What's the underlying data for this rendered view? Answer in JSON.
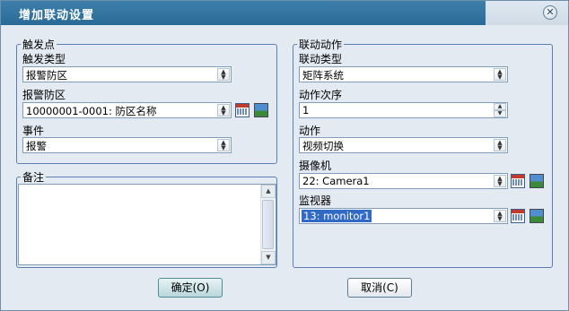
{
  "window": {
    "title": "增加联动设置",
    "close_icon": "close-icon"
  },
  "trigger": {
    "legend": "触发点",
    "type_label": "触发类型",
    "type_value": "报警防区",
    "zone_label": "报警防区",
    "zone_value": "10000001-0001: 防区名称",
    "event_label": "事件",
    "event_value": "报警"
  },
  "note": {
    "legend": "备注",
    "value": ""
  },
  "action": {
    "legend": "联动动作",
    "type_label": "联动类型",
    "type_value": "矩阵系统",
    "order_label": "动作次序",
    "order_value": "1",
    "action_label": "动作",
    "action_value": "视频切换",
    "camera_label": "摄像机",
    "camera_value": "22: Camera1",
    "monitor_label": "监视器",
    "monitor_value": "13: monitor1"
  },
  "buttons": {
    "ok": "确定(O)",
    "cancel": "取消(C)"
  },
  "icons": {
    "calendar": "calendar-icon",
    "picture": "picture-icon",
    "dropdown": "chevron-down-icon"
  }
}
